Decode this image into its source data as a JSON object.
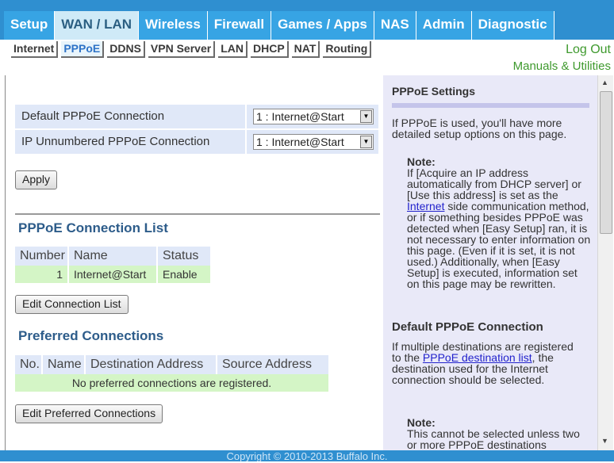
{
  "nav": {
    "tabs": [
      "Setup",
      "WAN / LAN",
      "Wireless",
      "Firewall",
      "Games / Apps",
      "NAS",
      "Admin",
      "Diagnostic"
    ],
    "active_tab": "WAN / LAN",
    "subtabs": [
      "Internet",
      "PPPoE",
      "DDNS",
      "VPN Server",
      "LAN",
      "DHCP",
      "NAT",
      "Routing"
    ],
    "active_subtab": "PPPoE",
    "logout": "Log Out",
    "manuals": "Manuals & Utilities"
  },
  "settings": {
    "default_label": "Default PPPoE Connection",
    "default_value": "1 : Internet@Start",
    "unnumbered_label": "IP Unnumbered PPPoE Connection",
    "unnumbered_value": "1 : Internet@Start",
    "apply_button": "Apply"
  },
  "connection_list": {
    "title": "PPPoE Connection List",
    "headers": [
      "Number",
      "Name",
      "Status"
    ],
    "rows": [
      {
        "number": "1",
        "name": "Internet@Start",
        "status": "Enable"
      }
    ],
    "edit_button": "Edit Connection List"
  },
  "preferred": {
    "title": "Preferred Connections",
    "headers": [
      "No.",
      "Name",
      "Destination Address",
      "Source Address"
    ],
    "empty_text": "No preferred connections are registered.",
    "edit_button": "Edit Preferred Connections"
  },
  "help": {
    "title": "PPPoE Settings",
    "intro": "If PPPoE is used, you'll have more detailed setup options on this page.",
    "note_label": "Note:",
    "note_text_1": "If [Acquire an IP address automatically from DHCP server] or [Use this address] is set as the",
    "note_link": "Internet",
    "note_text_2": "side communication method, or if something besides PPPoE was detected when [Easy Setup] ran, it is not necessary to enter information on this page. (Even if it is set, it is not used.) Additionally, when [Easy Setup] is executed, information set on this page may be rewritten.",
    "default_title": "Default PPPoE Connection",
    "default_text_1": "If multiple destinations are registered to the",
    "default_link": "PPPoE destination list",
    "default_text_2": ", the destination used for the Internet connection should be selected.",
    "note2_label": "Note:",
    "note2_text": "This cannot be selected unless two or more PPPoE destinations"
  },
  "footer": "Copyright © 2010-2013 Buffalo Inc.",
  "colors": {
    "nav_bg": "#2f8fd0",
    "accent_green": "#3f9a2e",
    "help_bg": "#e9e9f8",
    "row_green": "#d4f5c6"
  }
}
